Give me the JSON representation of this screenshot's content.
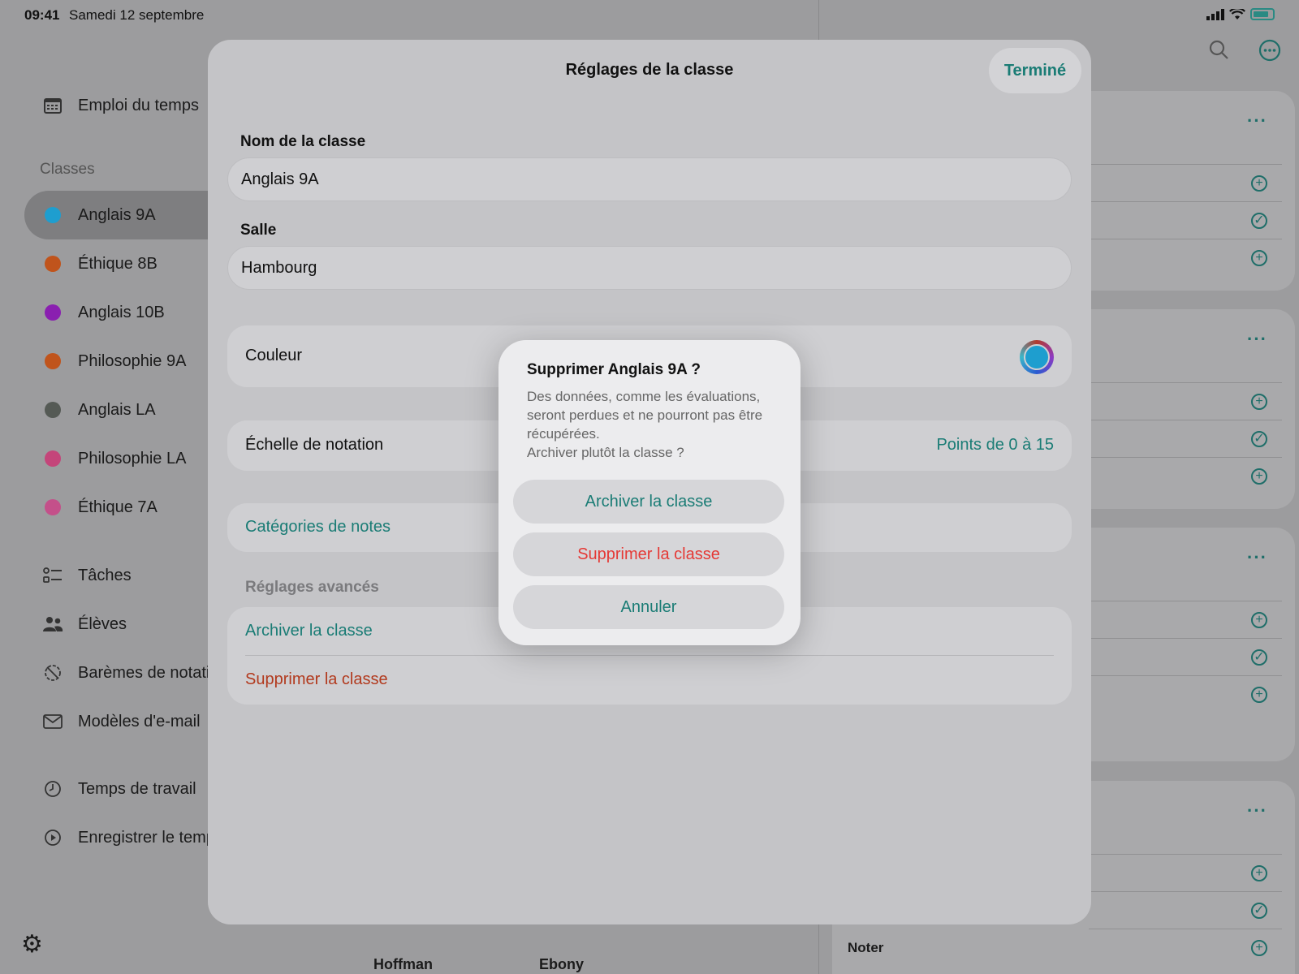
{
  "status_bar": {
    "time": "09:41",
    "date": "Samedi 12 septembre"
  },
  "sidebar": {
    "schedule_label": "Emploi du temps",
    "classes_heading": "Classes",
    "classes": [
      {
        "label": "Anglais 9A",
        "color": "#1e9ecf",
        "selected": true
      },
      {
        "label": "Éthique 8B",
        "color": "#c0541c"
      },
      {
        "label": "Anglais 10B",
        "color": "#8a1fb0"
      },
      {
        "label": "Philosophie 9A",
        "color": "#c0541c"
      },
      {
        "label": "Anglais LA",
        "color": "#555a55"
      },
      {
        "label": "Philosophie LA",
        "color": "#c4457a"
      },
      {
        "label": "Éthique 7A",
        "color": "#c4508a"
      }
    ],
    "tools": [
      {
        "label": "Tâches",
        "icon": "task-list-icon"
      },
      {
        "label": "Élèves",
        "icon": "people-icon"
      },
      {
        "label": "Barèmes de notati",
        "icon": "grading-scale-icon"
      },
      {
        "label": "Modèles d'e-mail",
        "icon": "envelope-icon"
      }
    ],
    "time_items": [
      {
        "label": "Temps de travail",
        "icon": "clock-icon"
      },
      {
        "label": "Enregistrer le temp",
        "icon": "play-circle-icon"
      }
    ]
  },
  "background": {
    "bottom_names": [
      "Hoffman",
      "Ebony"
    ],
    "right_bottom_label": "Noter"
  },
  "sheet": {
    "title": "Réglages de la classe",
    "done_label": "Terminé",
    "name_label": "Nom de la classe",
    "name_value": "Anglais 9A",
    "room_label": "Salle",
    "room_value": "Hambourg",
    "color_label": "Couleur",
    "color_value": "#1e9ecf",
    "grading_label": "Échelle de notation",
    "grading_value": "Points de 0 à 15",
    "categories_label": "Catégories de notes",
    "advanced_heading": "Réglages avancés",
    "archive_label": "Archiver la classe",
    "delete_label": "Supprimer la classe"
  },
  "alert": {
    "title": "Supprimer Anglais 9A ?",
    "message": "Des données, comme les évaluations, seront perdues et ne pourront pas être récupérées.\nArchiver plutôt la classe ?",
    "archive_button": "Archiver la classe",
    "delete_button": "Supprimer la classe",
    "cancel_button": "Annuler"
  },
  "colors": {
    "accent": "#1a7c75",
    "destructive": "#e53935"
  }
}
